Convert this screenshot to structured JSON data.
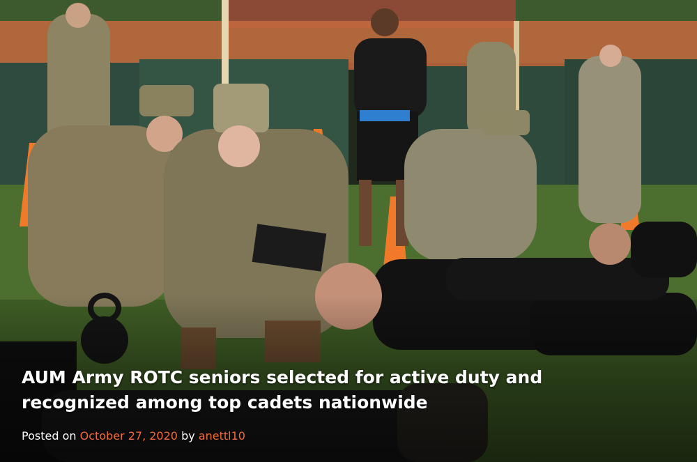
{
  "post": {
    "title": "AUM Army ROTC seniors selected for active duty and recognized among top cadets nationwide",
    "posted_on_label": "Posted on",
    "date": "October 27, 2020",
    "by_label": "by",
    "author": "anettl10"
  },
  "colors": {
    "link": "#f26b3a",
    "title": "#ffffff"
  }
}
